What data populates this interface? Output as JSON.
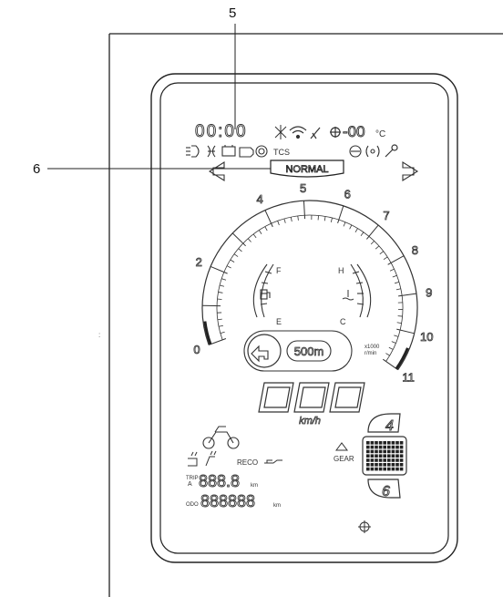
{
  "callouts": [
    {
      "number": "5"
    },
    {
      "number": "6"
    }
  ],
  "display": {
    "clock": "00:00",
    "temperature": "-00",
    "temp_unit": "°C",
    "tcs_label": "TCS",
    "mode": "NORMAL",
    "distance": "500m",
    "speed": "000",
    "speed_unit": "km/h",
    "gear_label": "GEAR",
    "gear_up": "4",
    "gear_down": "6",
    "eco_label": "RECO",
    "trip_label": "TRIP",
    "trip_sub": "A",
    "trip_value": "888.8",
    "trip_unit": "km",
    "odo_label": "ODO",
    "odo_value": "888888",
    "odo_unit": "km",
    "fuel_full": "F",
    "fuel_empty": "E",
    "temp_hot": "H",
    "temp_cold": "C",
    "rpm_unit_line1": "x1000",
    "rpm_unit_line2": "r/min"
  },
  "tachometer": {
    "min": 0,
    "max": 11,
    "labels": [
      "0",
      "2",
      "4",
      "5",
      "6",
      "7",
      "8",
      "9",
      "10",
      "11"
    ]
  },
  "icons": [
    "headlight-icon",
    "fog-light-icon",
    "battery-icon",
    "engine-check-icon",
    "abs-icon",
    "tcs-icon",
    "ice-warning-icon",
    "wifi-icon",
    "phone-icon",
    "thermometer-icon",
    "immobilizer-icon",
    "oil-pressure-icon",
    "wrench-icon",
    "left-turn-icon",
    "right-turn-icon",
    "fuel-pump-icon",
    "coolant-icon",
    "navigation-left-arrow-icon",
    "motorcycle-icon",
    "crosshair-icon"
  ]
}
